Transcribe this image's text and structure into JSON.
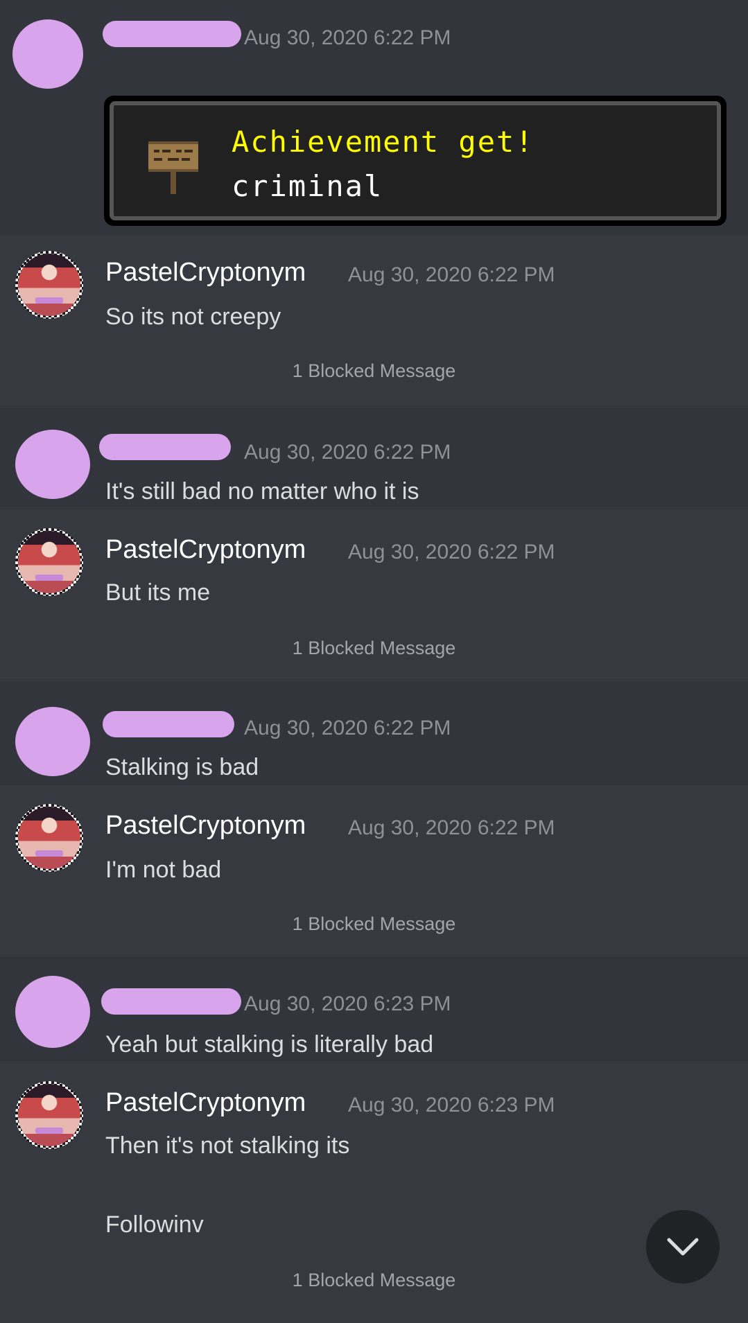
{
  "colors": {
    "background": "#36393f",
    "redaction": "#d8a4ec",
    "timestamp": "#8e9297",
    "achievement_title": "#ffff00"
  },
  "achievement": {
    "title": "Achievement get!",
    "subtitle": "criminal",
    "icon": "sign-icon"
  },
  "messages": [
    {
      "author": "",
      "timestamp": "Aug 30, 2020 6:22 PM",
      "text": ""
    },
    {
      "author": "PastelCryptonym",
      "timestamp": "Aug 30, 2020 6:22 PM",
      "text": "So its not creepy",
      "blocked": "1 Blocked Message"
    },
    {
      "author": "",
      "timestamp": "Aug 30, 2020 6:22 PM",
      "text": "It's still bad no matter who it is"
    },
    {
      "author": "PastelCryptonym",
      "timestamp": "Aug 30, 2020 6:22 PM",
      "text": "But its me",
      "blocked": "1 Blocked Message"
    },
    {
      "author": "",
      "timestamp": "Aug 30, 2020 6:22 PM",
      "text": "Stalking is bad"
    },
    {
      "author": "PastelCryptonym",
      "timestamp": "Aug 30, 2020 6:22 PM",
      "text": "I'm not bad",
      "blocked": "1 Blocked Message"
    },
    {
      "author": "",
      "timestamp": "Aug 30, 2020 6:23 PM",
      "text": "Yeah but stalking is literally bad"
    },
    {
      "author": "PastelCryptonym",
      "timestamp": "Aug 30, 2020 6:23 PM",
      "text": "Then it's not stalking its",
      "text2": "Followinv",
      "blocked": "1 Blocked Message"
    }
  ],
  "scroll_button": {
    "icon": "chevron-down-icon"
  }
}
